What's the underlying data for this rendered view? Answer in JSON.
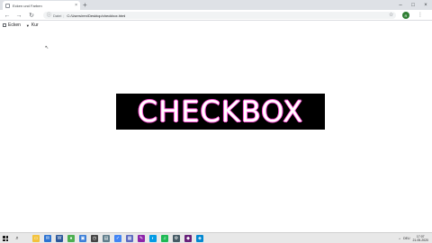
{
  "browser": {
    "tab": {
      "title": "Ecken und Farben",
      "close": "×"
    },
    "new_tab": "+",
    "window_controls": {
      "minimize": "–",
      "maximize": "□",
      "close": "×"
    },
    "nav": {
      "back": "←",
      "forward": "→",
      "reload": "↻"
    },
    "omnibox": {
      "info": "ⓘ",
      "label": "Datei",
      "separator": "|",
      "url": "C:/Users/ren/Desktop/checkbox.html"
    },
    "bookmark_star": "☆",
    "profile_initial": "R",
    "menu": "⋮"
  },
  "page": {
    "toolbar": [
      {
        "label": "Ecken",
        "marker": "checkbox"
      },
      {
        "label": "Kur",
        "marker": "arrow",
        "arrow": "▼"
      }
    ],
    "cursor_glyph": "↖",
    "banner_text": "CHECKBOX",
    "banner_colors": {
      "background": "#000000",
      "text": "#ffffff",
      "glow": "#ff4fd8"
    }
  },
  "taskbar": {
    "search_glyph": "⌕",
    "pinned_apps": [
      {
        "name": "file-explorer",
        "color": "#f3c23c",
        "glyph": "▭"
      },
      {
        "name": "mail",
        "color": "#2c73d2",
        "glyph": "✉"
      },
      {
        "name": "word",
        "color": "#2b579a",
        "glyph": "W"
      },
      {
        "name": "chrome",
        "color": "#4caf50",
        "glyph": "●"
      },
      {
        "name": "photos",
        "color": "#3c7fd8",
        "glyph": "▣"
      },
      {
        "name": "clock",
        "color": "#444444",
        "glyph": "◷"
      },
      {
        "name": "files",
        "color": "#607d8b",
        "glyph": "▤"
      },
      {
        "name": "tasks",
        "color": "#4285f4",
        "glyph": "✓"
      },
      {
        "name": "calendar",
        "color": "#5c6bc0",
        "glyph": "▦"
      },
      {
        "name": "notepad",
        "color": "#8e24aa",
        "glyph": "✎"
      },
      {
        "name": "weather",
        "color": "#039be5",
        "glyph": "◐"
      },
      {
        "name": "spotify",
        "color": "#1db954",
        "glyph": "♫"
      },
      {
        "name": "settings",
        "color": "#455a64",
        "glyph": "⚙"
      },
      {
        "name": "visual-studio",
        "color": "#68217a",
        "glyph": "◆"
      },
      {
        "name": "network",
        "color": "#0288d1",
        "glyph": "◈"
      }
    ],
    "tray": {
      "chevron": "^",
      "language": "DEU",
      "time": "17:07",
      "date": "21.05.2020"
    }
  }
}
